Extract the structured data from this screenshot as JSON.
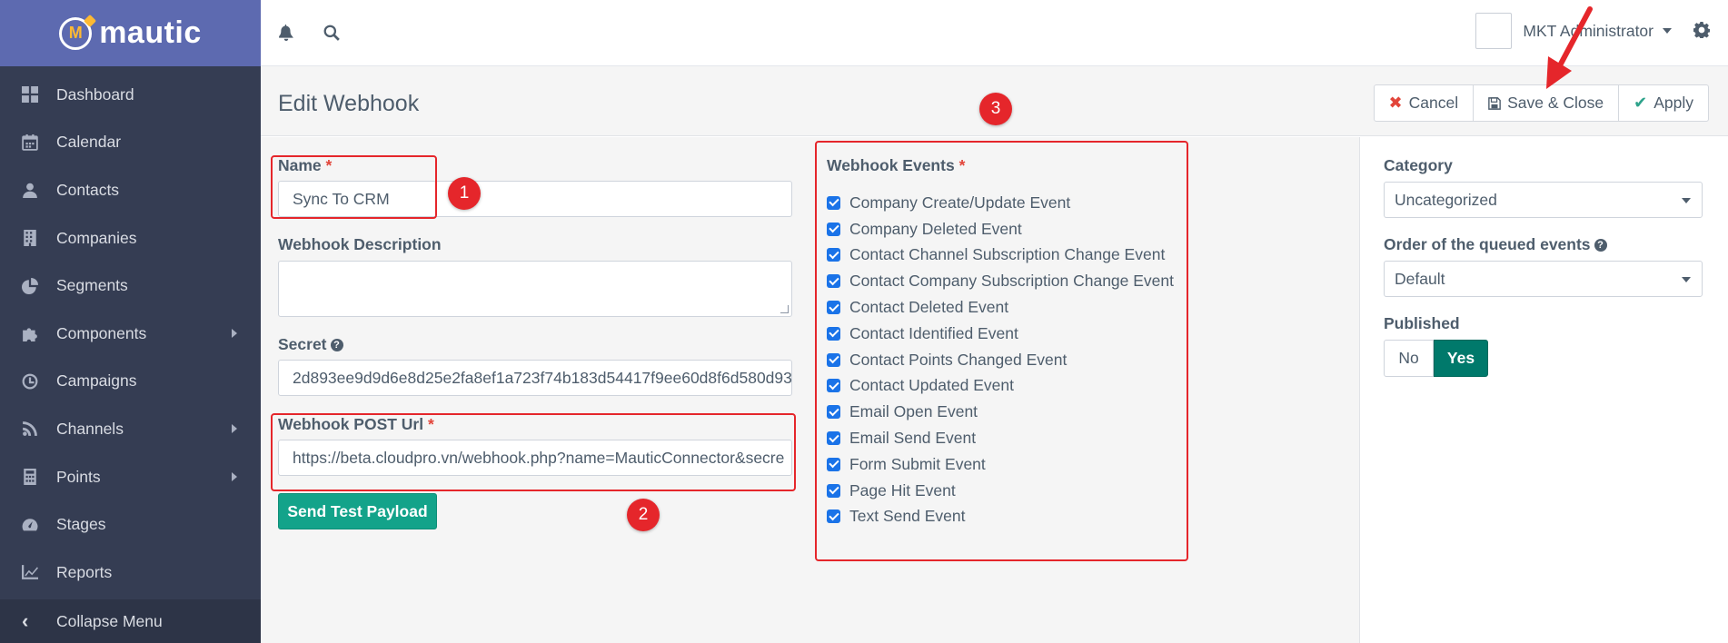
{
  "brand": {
    "name": "mautic"
  },
  "sidebar": {
    "items": [
      {
        "label": "Dashboard",
        "icon": "dashboard-icon"
      },
      {
        "label": "Calendar",
        "icon": "calendar-icon"
      },
      {
        "label": "Contacts",
        "icon": "user-icon"
      },
      {
        "label": "Companies",
        "icon": "building-icon"
      },
      {
        "label": "Segments",
        "icon": "pie-chart-icon"
      },
      {
        "label": "Components",
        "icon": "puzzle-icon",
        "has_submenu": true
      },
      {
        "label": "Campaigns",
        "icon": "clock-icon"
      },
      {
        "label": "Channels",
        "icon": "rss-icon",
        "has_submenu": true
      },
      {
        "label": "Points",
        "icon": "calculator-icon",
        "has_submenu": true
      },
      {
        "label": "Stages",
        "icon": "tachometer-icon"
      },
      {
        "label": "Reports",
        "icon": "line-chart-icon"
      }
    ],
    "collapse_label": "Collapse Menu"
  },
  "topbar": {
    "user_name": "MKT Administrator"
  },
  "header": {
    "title": "Edit Webhook",
    "cancel_label": "Cancel",
    "save_close_label": "Save & Close",
    "apply_label": "Apply"
  },
  "form": {
    "name_label": "Name",
    "name_value": "Sync To CRM",
    "description_label": "Webhook Description",
    "description_value": "",
    "secret_label": "Secret",
    "secret_value": "2d893ee9d9d6e8d25e2fa8ef1a723f74b183d54417f9ee60d8f6d580d93",
    "url_label": "Webhook POST Url",
    "url_value": "https://beta.cloudpro.vn/webhook.php?name=MauticConnector&secre",
    "send_test_label": "Send Test Payload",
    "required_mark": "*"
  },
  "events": {
    "label": "Webhook Events",
    "items": [
      {
        "label": "Company Create/Update Event",
        "checked": true
      },
      {
        "label": "Company Deleted Event",
        "checked": true
      },
      {
        "label": "Contact Channel Subscription Change Event",
        "checked": true
      },
      {
        "label": "Contact Company Subscription Change Event",
        "checked": true
      },
      {
        "label": "Contact Deleted Event",
        "checked": true
      },
      {
        "label": "Contact Identified Event",
        "checked": true
      },
      {
        "label": "Contact Points Changed Event",
        "checked": true
      },
      {
        "label": "Contact Updated Event",
        "checked": true
      },
      {
        "label": "Email Open Event",
        "checked": true
      },
      {
        "label": "Email Send Event",
        "checked": true
      },
      {
        "label": "Form Submit Event",
        "checked": true
      },
      {
        "label": "Page Hit Event",
        "checked": true
      },
      {
        "label": "Text Send Event",
        "checked": true
      }
    ]
  },
  "side": {
    "category_label": "Category",
    "category_value": "Uncategorized",
    "order_label": "Order of the queued events",
    "order_value": "Default",
    "published_label": "Published",
    "no_label": "No",
    "yes_label": "Yes",
    "published_value": "Yes"
  },
  "annotations": {
    "n1": "1",
    "n2": "2",
    "n3": "3"
  },
  "colors": {
    "sidebar": "#353d53",
    "brand": "#5d6ab0",
    "accent": "#13a38a",
    "annotation": "#e5262b",
    "checkbox": "#1a73e8"
  }
}
